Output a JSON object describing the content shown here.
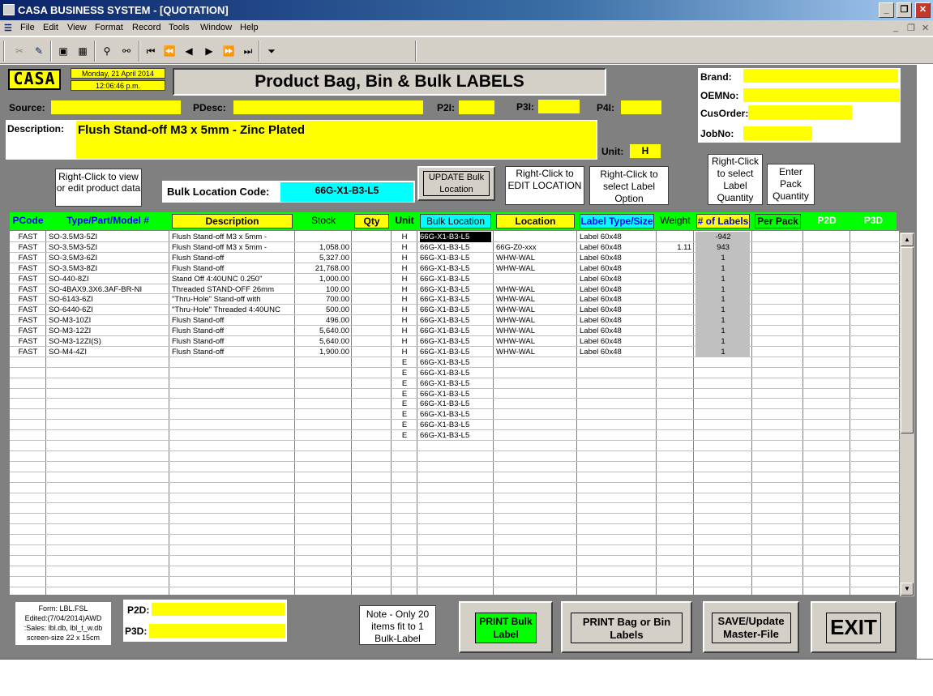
{
  "window": {
    "title": "CASA BUSINESS SYSTEM - [QUOTATION]"
  },
  "menu": [
    "File",
    "Edit",
    "View",
    "Format",
    "Record",
    "Tools",
    "Window",
    "Help"
  ],
  "header": {
    "logo": "CASA",
    "date": "Monday, 21 April 2014",
    "time": "12:06:46 p.m.",
    "form_title": "Product Bag, Bin & Bulk LABELS"
  },
  "fields": {
    "source_label": "Source:",
    "source_value": "",
    "pdesc_label": "PDesc:",
    "pdesc_value": "",
    "p2i_label": "P2I:",
    "p3i_label": "P3I:",
    "p4i_label": "P4I:",
    "brand_label": "Brand:",
    "oemno_label": "OEMNo:",
    "cusorder_label": "CusOrder:",
    "jobno_label": "JobNo:",
    "description_label": "Description:",
    "description_value": "Flush Stand-off M3 x 5mm - Zinc Plated",
    "unit_label": "Unit:",
    "unit_value": "H",
    "bulk_location_label": "Bulk Location Code:",
    "bulk_location_value": "66G-X1-B3-L5"
  },
  "buttons": {
    "right_click_view": "Right-Click to view or edit product data",
    "update_bulk": "UPDATE Bulk Location",
    "edit_location": "Right-Click to EDIT LOCATION",
    "select_label_option": "Right-Click to select Label Option",
    "select_label_qty": "Right-Click to select Label Quantity",
    "enter_pack_qty": "Enter Pack Quantity",
    "print_bulk": "PRINT Bulk Label",
    "print_bag": "PRINT Bag or Bin Labels",
    "save_master": "SAVE/Update Master-File",
    "exit": "EXIT"
  },
  "footer": {
    "form_info": [
      "Form: LBL.FSL",
      "Edited:(7/04/2014)AWD",
      ":Sales: lbl.db, lbl_t_w.db",
      "screen-size 22 x 15cm"
    ],
    "p2d_label": "P2D:",
    "p3d_label": "P3D:",
    "note": "Note - Only 20 items fit to 1 Bulk-Label"
  },
  "columns": [
    "PCode",
    "Type/Part/Model #",
    "Description",
    "Stock",
    "Qty",
    "Unit",
    "Bulk Location",
    "Location",
    "Label Type/Size",
    "Weight",
    "# of Labels",
    "Per Pack",
    "P2D",
    "P3D"
  ],
  "rows": [
    {
      "pcode": "FAST",
      "part": "SO-3.5M3-5ZI",
      "desc": "Flush Stand-off M3 x 5mm -",
      "stock": "",
      "unit": "H",
      "bulk": "66G-X1-B3-L5",
      "loc": "",
      "label": "Label 60x48",
      "weight": "",
      "labels": "-942"
    },
    {
      "pcode": "FAST",
      "part": "SO-3.5M3-5ZI",
      "desc": "Flush Stand-off M3 x 5mm -",
      "stock": "1,058.00",
      "unit": "H",
      "bulk": "66G-X1-B3-L5",
      "loc": "66G-Z0-xxx",
      "label": "Label 60x48",
      "weight": "1.11",
      "labels": "943"
    },
    {
      "pcode": "FAST",
      "part": "SO-3.5M3-6ZI",
      "desc": "Flush Stand-off",
      "stock": "5,327.00",
      "unit": "H",
      "bulk": "66G-X1-B3-L5",
      "loc": "WHW-WAL",
      "label": "Label 60x48",
      "weight": "",
      "labels": "1"
    },
    {
      "pcode": "FAST",
      "part": "SO-3.5M3-8ZI",
      "desc": "Flush Stand-off",
      "stock": "21,768.00",
      "unit": "H",
      "bulk": "66G-X1-B3-L5",
      "loc": "WHW-WAL",
      "label": "Label 60x48",
      "weight": "",
      "labels": "1"
    },
    {
      "pcode": "FAST",
      "part": "SO-440-8ZI",
      "desc": "Stand Off 4:40UNC 0.250\"",
      "stock": "1,000.00",
      "unit": "H",
      "bulk": "66G-X1-B3-L5",
      "loc": "",
      "label": "Label 60x48",
      "weight": "",
      "labels": "1"
    },
    {
      "pcode": "FAST",
      "part": "SO-4BAX9.3X6.3AF-BR-NI",
      "desc": "Threaded STAND-OFF 26mm",
      "stock": "100.00",
      "unit": "H",
      "bulk": "66G-X1-B3-L5",
      "loc": "WHW-WAL",
      "label": "Label 60x48",
      "weight": "",
      "labels": "1"
    },
    {
      "pcode": "FAST",
      "part": "SO-6143-6ZI",
      "desc": "\"Thru-Hole\" Stand-off with",
      "stock": "700.00",
      "unit": "H",
      "bulk": "66G-X1-B3-L5",
      "loc": "WHW-WAL",
      "label": "Label 60x48",
      "weight": "",
      "labels": "1"
    },
    {
      "pcode": "FAST",
      "part": "SO-6440-6ZI",
      "desc": "\"Thru-Hole\" Threaded 4:40UNC",
      "stock": "500.00",
      "unit": "H",
      "bulk": "66G-X1-B3-L5",
      "loc": "WHW-WAL",
      "label": "Label 60x48",
      "weight": "",
      "labels": "1"
    },
    {
      "pcode": "FAST",
      "part": "SO-M3-10ZI",
      "desc": "Flush Stand-off",
      "stock": "496.00",
      "unit": "H",
      "bulk": "66G-X1-B3-L5",
      "loc": "WHW-WAL",
      "label": "Label 60x48",
      "weight": "",
      "labels": "1"
    },
    {
      "pcode": "FAST",
      "part": "SO-M3-12ZI",
      "desc": "Flush Stand-off",
      "stock": "5,640.00",
      "unit": "H",
      "bulk": "66G-X1-B3-L5",
      "loc": "WHW-WAL",
      "label": "Label 60x48",
      "weight": "",
      "labels": "1"
    },
    {
      "pcode": "FAST",
      "part": "SO-M3-12ZI(S)",
      "desc": "Flush Stand-off",
      "stock": "5,640.00",
      "unit": "H",
      "bulk": "66G-X1-B3-L5",
      "loc": "WHW-WAL",
      "label": "Label 60x48",
      "weight": "",
      "labels": "1"
    },
    {
      "pcode": "FAST",
      "part": "SO-M4-4ZI",
      "desc": "Flush Stand-off",
      "stock": "1,900.00",
      "unit": "H",
      "bulk": "66G-X1-B3-L5",
      "loc": "WHW-WAL",
      "label": "Label 60x48",
      "weight": "",
      "labels": "1"
    },
    {
      "pcode": "",
      "part": "",
      "desc": "",
      "stock": "",
      "unit": "E",
      "bulk": "66G-X1-B3-L5",
      "loc": "",
      "label": "",
      "weight": "",
      "labels": ""
    },
    {
      "pcode": "",
      "part": "",
      "desc": "",
      "stock": "",
      "unit": "E",
      "bulk": "66G-X1-B3-L5",
      "loc": "",
      "label": "",
      "weight": "",
      "labels": ""
    },
    {
      "pcode": "",
      "part": "",
      "desc": "",
      "stock": "",
      "unit": "E",
      "bulk": "66G-X1-B3-L5",
      "loc": "",
      "label": "",
      "weight": "",
      "labels": ""
    },
    {
      "pcode": "",
      "part": "",
      "desc": "",
      "stock": "",
      "unit": "E",
      "bulk": "66G-X1-B3-L5",
      "loc": "",
      "label": "",
      "weight": "",
      "labels": ""
    },
    {
      "pcode": "",
      "part": "",
      "desc": "",
      "stock": "",
      "unit": "E",
      "bulk": "66G-X1-B3-L5",
      "loc": "",
      "label": "",
      "weight": "",
      "labels": ""
    },
    {
      "pcode": "",
      "part": "",
      "desc": "",
      "stock": "",
      "unit": "E",
      "bulk": "66G-X1-B3-L5",
      "loc": "",
      "label": "",
      "weight": "",
      "labels": ""
    },
    {
      "pcode": "",
      "part": "",
      "desc": "",
      "stock": "",
      "unit": "E",
      "bulk": "66G-X1-B3-L5",
      "loc": "",
      "label": "",
      "weight": "",
      "labels": ""
    },
    {
      "pcode": "",
      "part": "",
      "desc": "",
      "stock": "",
      "unit": "E",
      "bulk": "66G-X1-B3-L5",
      "loc": "",
      "label": "",
      "weight": "",
      "labels": ""
    }
  ]
}
